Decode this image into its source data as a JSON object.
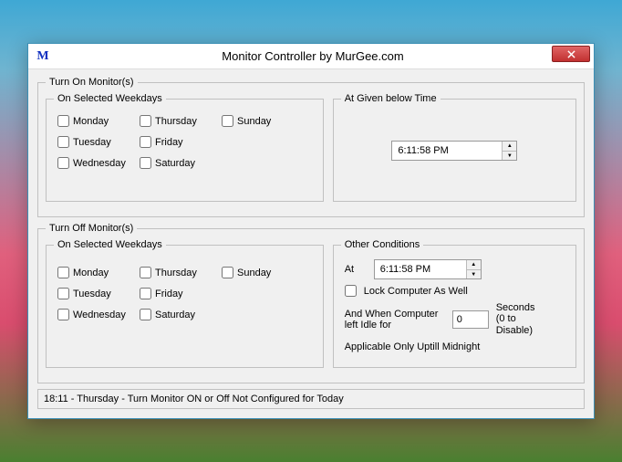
{
  "window": {
    "title": "Monitor Controller by MurGee.com",
    "icon_letter": "M"
  },
  "turn_on": {
    "group_label": "Turn On Monitor(s)",
    "weekdays_label": "On Selected Weekdays",
    "time_label": "At Given below Time",
    "time_value": "6:11:58 PM",
    "days": {
      "monday": "Monday",
      "tuesday": "Tuesday",
      "wednesday": "Wednesday",
      "thursday": "Thursday",
      "friday": "Friday",
      "saturday": "Saturday",
      "sunday": "Sunday"
    }
  },
  "turn_off": {
    "group_label": "Turn Off Monitor(s)",
    "weekdays_label": "On Selected Weekdays",
    "other_label": "Other Conditions",
    "at_label": "At",
    "time_value": "6:11:58 PM",
    "lock_label": "Lock Computer As Well",
    "idle_label": "And When Computer left Idle for",
    "idle_value": "0",
    "seconds_label": "Seconds (0 to Disable)",
    "applicable_label": "Applicable Only Uptill Midnight",
    "days": {
      "monday": "Monday",
      "tuesday": "Tuesday",
      "wednesday": "Wednesday",
      "thursday": "Thursday",
      "friday": "Friday",
      "saturday": "Saturday",
      "sunday": "Sunday"
    }
  },
  "status": "18:11 - Thursday - Turn Monitor ON or Off Not Configured for Today"
}
